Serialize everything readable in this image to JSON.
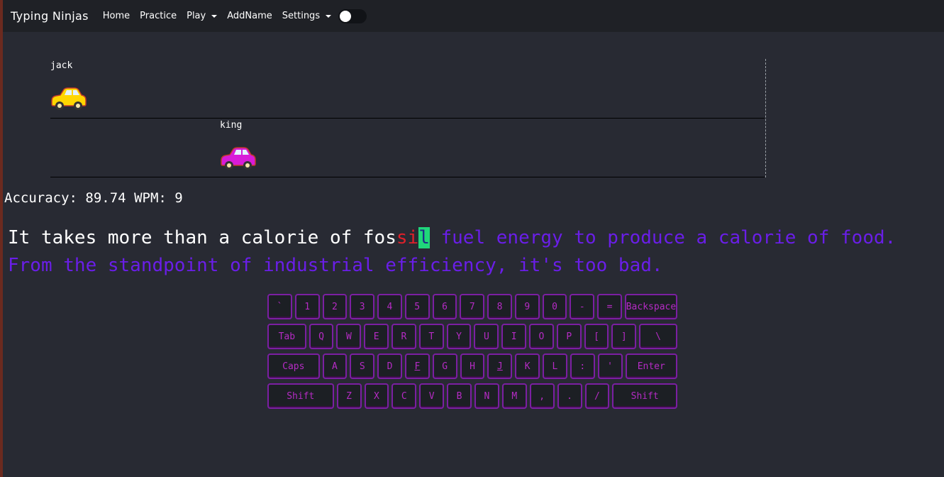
{
  "navbar": {
    "brand": "Typing Ninjas",
    "items": [
      {
        "label": "Home",
        "dropdown": false
      },
      {
        "label": "Practice",
        "dropdown": false
      },
      {
        "label": "Play",
        "dropdown": true
      },
      {
        "label": "AddName",
        "dropdown": false
      },
      {
        "label": "Settings",
        "dropdown": true
      }
    ],
    "dark_mode_toggle": "on"
  },
  "race": {
    "racers": [
      {
        "name": "jack",
        "car_color": "#ffd600",
        "progress_fraction": 0.0
      },
      {
        "name": "king",
        "car_color": "#d81bd8",
        "progress_fraction": 0.25
      }
    ]
  },
  "stats": {
    "accuracy_label": "Accuracy:",
    "accuracy_value": "89.74",
    "wpm_label": "WPM:",
    "wpm_value": "9"
  },
  "passage": {
    "typed": "It takes more than a calorie of fos",
    "wrong": "si",
    "current": "l",
    "remaining": " fuel energy to produce a calorie of food. From the standpoint of industrial efficiency, it's too bad."
  },
  "keyboard": {
    "rows": [
      [
        {
          "label": "`",
          "w": 35
        },
        {
          "label": "1",
          "w": 35
        },
        {
          "label": "2",
          "w": 35
        },
        {
          "label": "3",
          "w": 35
        },
        {
          "label": "4",
          "w": 35
        },
        {
          "label": "5",
          "w": 35
        },
        {
          "label": "6",
          "w": 35
        },
        {
          "label": "7",
          "w": 35
        },
        {
          "label": "8",
          "w": 35
        },
        {
          "label": "9",
          "w": 35
        },
        {
          "label": "0",
          "w": 35
        },
        {
          "label": "-",
          "w": 35
        },
        {
          "label": "=",
          "w": 35
        },
        {
          "label": "Backspace",
          "w": 74
        }
      ],
      [
        {
          "label": "Tab",
          "w": 55
        },
        {
          "label": "Q",
          "w": 35
        },
        {
          "label": "W",
          "w": 35
        },
        {
          "label": "E",
          "w": 35
        },
        {
          "label": "R",
          "w": 35
        },
        {
          "label": "T",
          "w": 35
        },
        {
          "label": "Y",
          "w": 35
        },
        {
          "label": "U",
          "w": 35
        },
        {
          "label": "I",
          "w": 35
        },
        {
          "label": "O",
          "w": 35
        },
        {
          "label": "P",
          "w": 35
        },
        {
          "label": "[",
          "w": 35
        },
        {
          "label": "]",
          "w": 35
        },
        {
          "label": "\\",
          "w": 54
        }
      ],
      [
        {
          "label": "Caps",
          "w": 74
        },
        {
          "label": "A",
          "w": 35
        },
        {
          "label": "S",
          "w": 35
        },
        {
          "label": "D",
          "w": 35
        },
        {
          "label": "F",
          "w": 35,
          "u": true
        },
        {
          "label": "G",
          "w": 35
        },
        {
          "label": "H",
          "w": 35
        },
        {
          "label": "J",
          "w": 35,
          "u": true
        },
        {
          "label": "K",
          "w": 35
        },
        {
          "label": "L",
          "w": 35
        },
        {
          "label": ":",
          "w": 35
        },
        {
          "label": "'",
          "w": 35
        },
        {
          "label": "Enter",
          "w": 74
        }
      ],
      [
        {
          "label": "Shift",
          "w": 94
        },
        {
          "label": "Z",
          "w": 35
        },
        {
          "label": "X",
          "w": 35
        },
        {
          "label": "C",
          "w": 35
        },
        {
          "label": "V",
          "w": 35
        },
        {
          "label": "B",
          "w": 35
        },
        {
          "label": "N",
          "w": 35
        },
        {
          "label": "M",
          "w": 35
        },
        {
          "label": ",",
          "w": 35
        },
        {
          "label": ".",
          "w": 35
        },
        {
          "label": "/",
          "w": 35
        },
        {
          "label": "Shift",
          "w": 92
        }
      ]
    ]
  }
}
